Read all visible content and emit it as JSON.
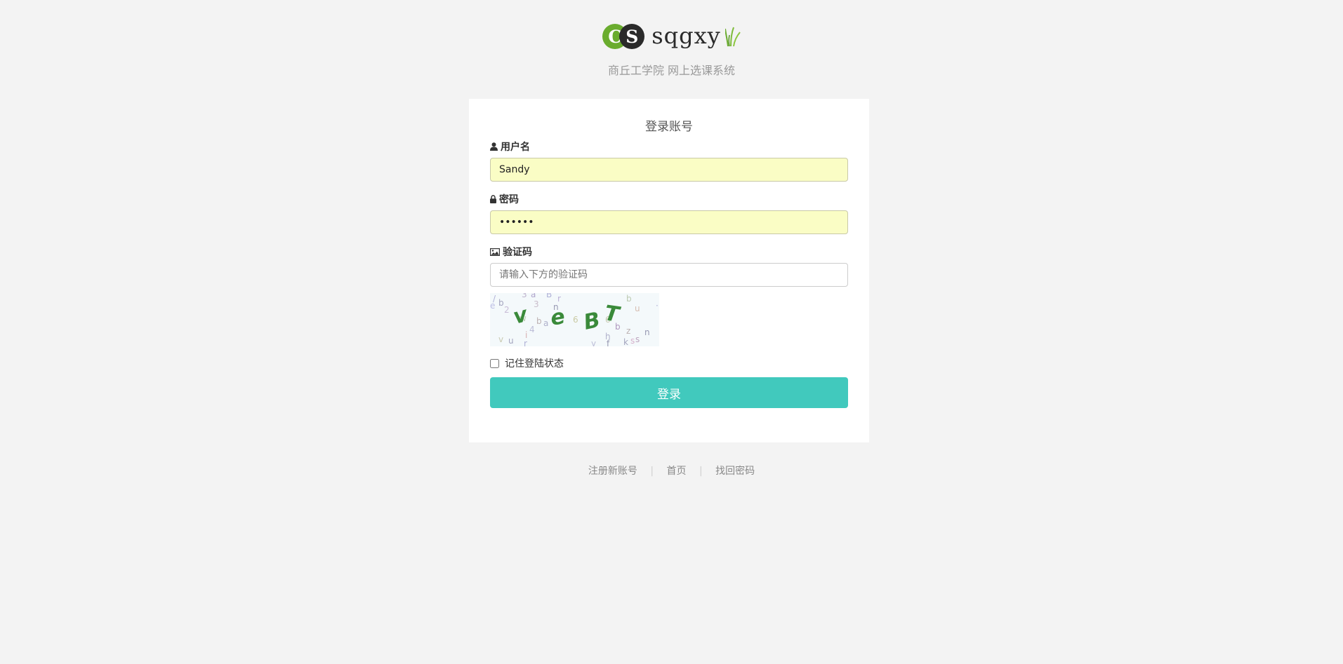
{
  "header": {
    "logo_letters": [
      "C",
      "S"
    ],
    "logo_text": "sqgxy",
    "subtitle": "商丘工学院 网上选课系统",
    "colors": {
      "logo_green": "#6aac2e",
      "logo_dark": "#2a2a2a"
    }
  },
  "login": {
    "title": "登录账号",
    "username": {
      "icon": "user-icon",
      "label": "用户名",
      "value": "Sandy"
    },
    "password": {
      "icon": "lock-icon",
      "label": "密码",
      "value": "••••••"
    },
    "captcha": {
      "icon": "image-icon",
      "label": "验证码",
      "placeholder": "请输入下方的验证码",
      "code": [
        "v",
        "e",
        "B",
        "T"
      ]
    },
    "remember_label": "记住登陆状态",
    "submit_label": "登录",
    "colors": {
      "button": "#41c9bd",
      "autofill": "#fafdc5"
    }
  },
  "footer": {
    "links": [
      "注册新账号",
      "首页",
      "找回密码"
    ],
    "separator": "|"
  }
}
